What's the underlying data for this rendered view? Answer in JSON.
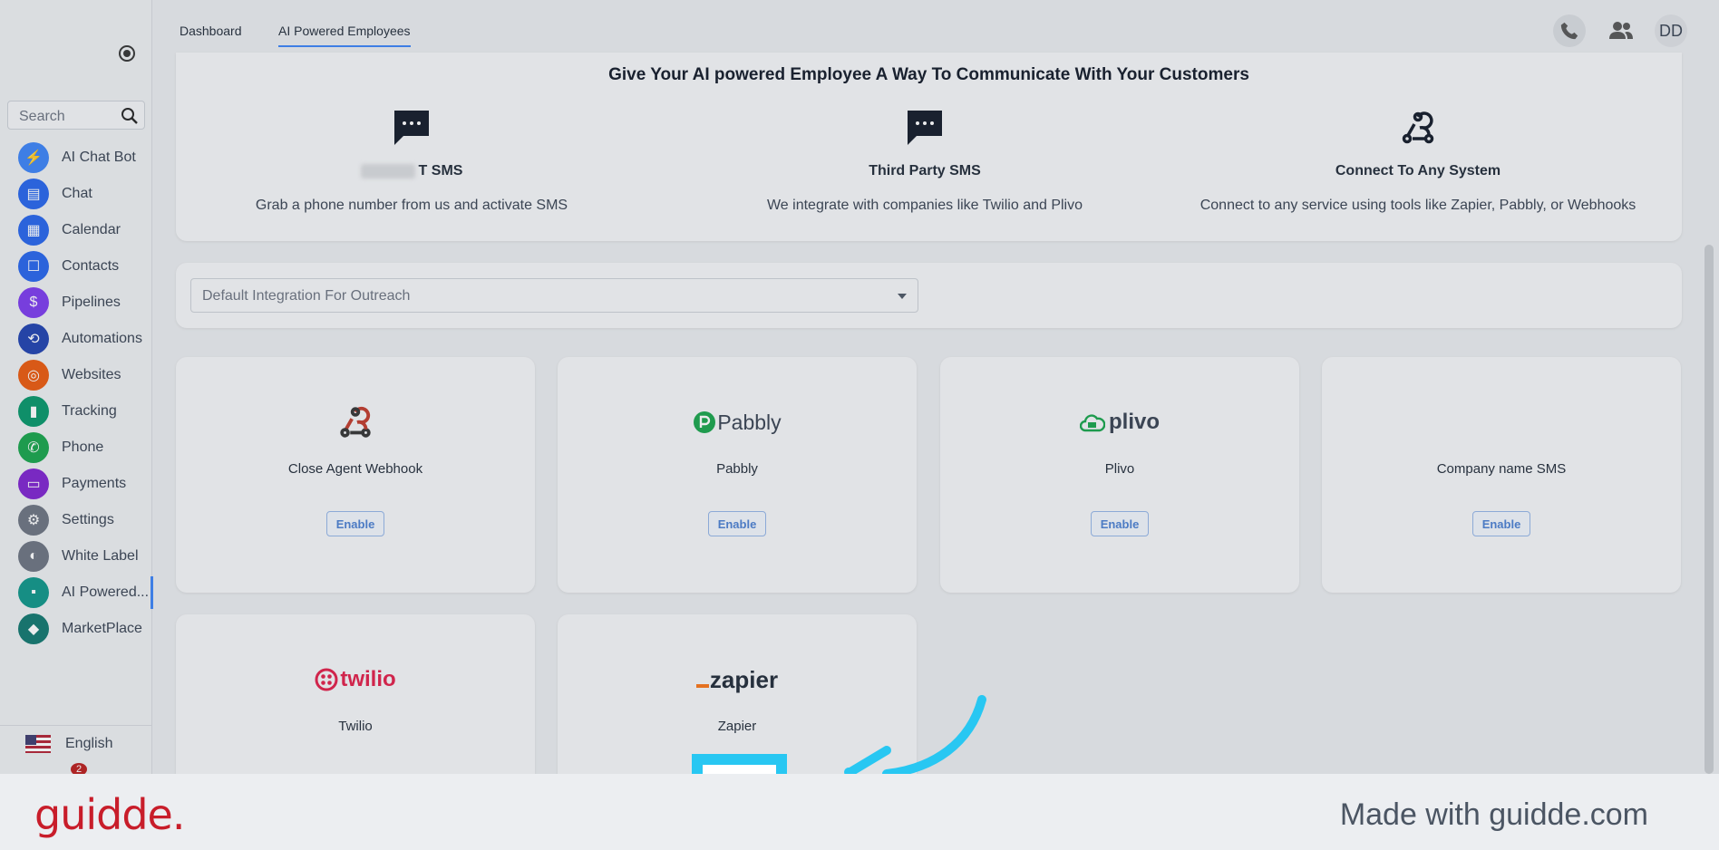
{
  "sidebar": {
    "search_placeholder": "Search",
    "items": [
      {
        "label": "AI Chat Bot",
        "icon": "bolt-icon",
        "color": "#3b82f6",
        "glyph": "⚡"
      },
      {
        "label": "Chat",
        "icon": "chat-icon",
        "color": "#2563eb",
        "glyph": "▤"
      },
      {
        "label": "Calendar",
        "icon": "calendar-icon",
        "color": "#2563eb",
        "glyph": "▦"
      },
      {
        "label": "Contacts",
        "icon": "contacts-icon",
        "color": "#2563eb",
        "glyph": "☐"
      },
      {
        "label": "Pipelines",
        "icon": "dollar-icon",
        "color": "#7c3aed",
        "glyph": "$"
      },
      {
        "label": "Automations",
        "icon": "automation-icon",
        "color": "#1e40af",
        "glyph": "⟲"
      },
      {
        "label": "Websites",
        "icon": "websites-icon",
        "color": "#ea580c",
        "glyph": "◎"
      },
      {
        "label": "Tracking",
        "icon": "chart-icon",
        "color": "#059669",
        "glyph": "▮"
      },
      {
        "label": "Phone",
        "icon": "phone-icon",
        "color": "#16a34a",
        "glyph": "✆"
      },
      {
        "label": "Payments",
        "icon": "card-icon",
        "color": "#7e22ce",
        "glyph": "▭"
      },
      {
        "label": "Settings",
        "icon": "gear-icon",
        "color": "#6b7280",
        "glyph": "⚙"
      },
      {
        "label": "White Label",
        "icon": "palette-icon",
        "color": "#6b7280",
        "glyph": "◐"
      },
      {
        "label": "AI Powered...",
        "icon": "ai-chat-icon",
        "color": "#0d9488",
        "glyph": "▪"
      },
      {
        "label": "MarketPlace",
        "icon": "marketplace-icon",
        "color": "#0f766e",
        "glyph": "◆"
      }
    ],
    "language": "English",
    "notification_count": "2"
  },
  "topbar": {
    "tabs": [
      "Dashboard",
      "AI Powered Employees"
    ],
    "avatar": "DD"
  },
  "hero": {
    "title": "Give Your AI powered Employee A Way To Communicate With Your Customers",
    "options": [
      {
        "name_suffix": "T SMS",
        "desc": "Grab a phone number from us and activate SMS"
      },
      {
        "name": "Third Party SMS",
        "desc": "We integrate with companies like Twilio and Plivo"
      },
      {
        "name": "Connect To Any System",
        "desc": "Connect to any service using tools like Zapier, Pabbly, or Webhooks"
      }
    ]
  },
  "outreach_select": {
    "placeholder": "Default Integration For Outreach"
  },
  "integrations": [
    {
      "name": "Close Agent Webhook",
      "button": "Enable"
    },
    {
      "name": "Pabbly",
      "logo": "Pabbly",
      "button": "Enable"
    },
    {
      "name": "Plivo",
      "logo": "plivo",
      "button": "Enable"
    },
    {
      "name": "Company name SMS",
      "button": "Enable"
    },
    {
      "name": "Twilio",
      "logo": "twilio"
    },
    {
      "name": "Zapier",
      "logo": "zapier"
    }
  ],
  "footer": {
    "brand": "guidde.",
    "made_with": "Made with guidde.com"
  },
  "colors": {
    "accent": "#3b82f6",
    "highlight": "#28c7f2",
    "brand": "#c81d2a"
  }
}
